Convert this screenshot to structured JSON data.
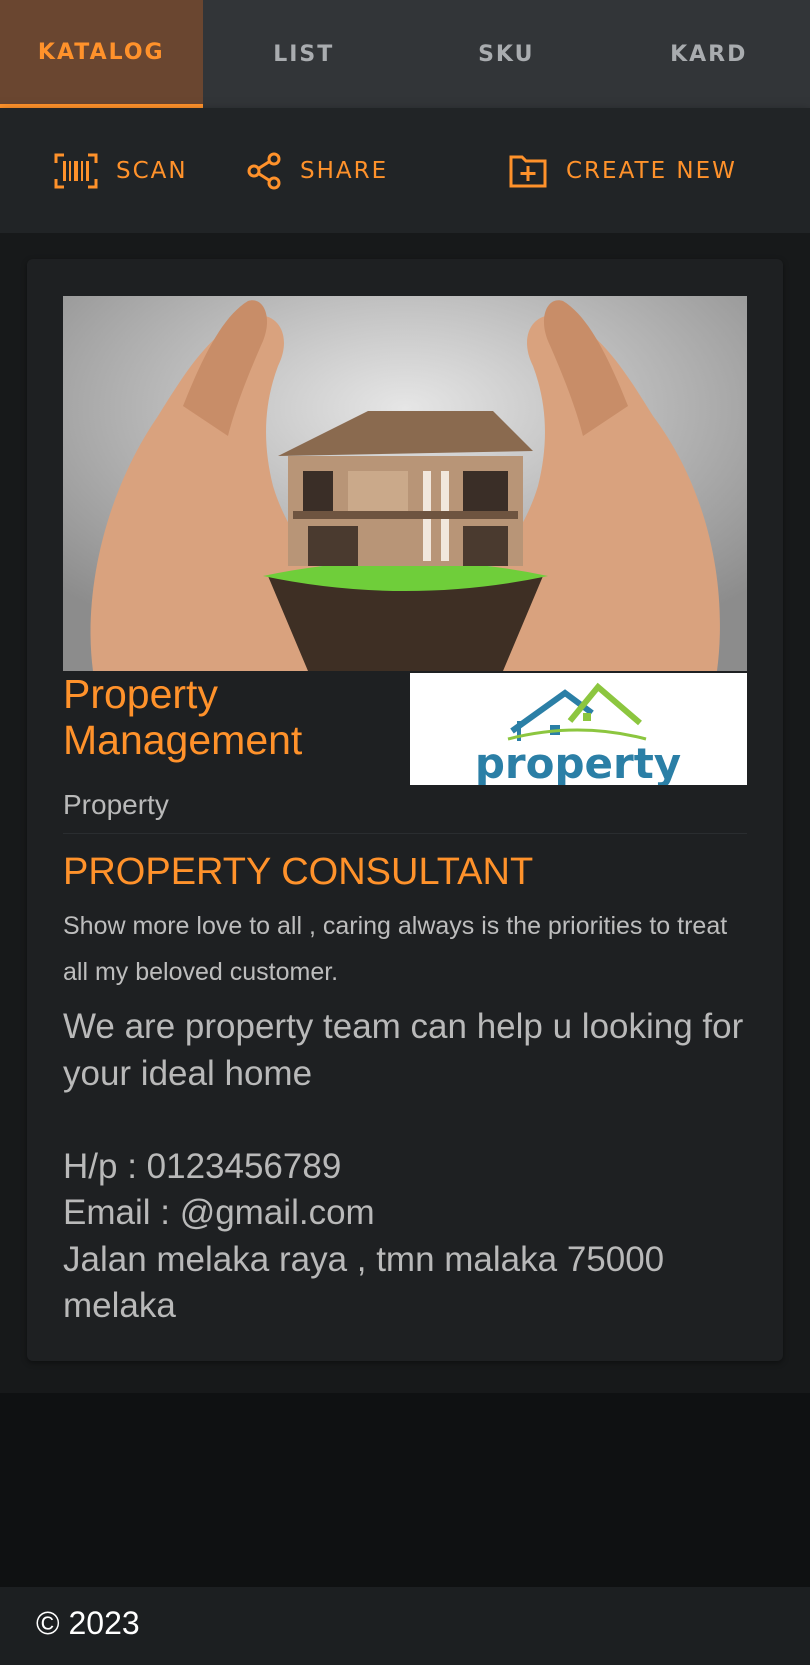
{
  "tabs": [
    {
      "label": "KATALOG",
      "active": true
    },
    {
      "label": "LIST",
      "active": false
    },
    {
      "label": "SKU",
      "active": false
    },
    {
      "label": "KARD",
      "active": false
    }
  ],
  "toolbar": {
    "scan_label": "SCAN",
    "scan_icon": "barcode-scan-icon",
    "share_label": "SHARE",
    "share_icon": "share-icon",
    "create_label": "CREATE NEW",
    "create_icon": "add-box-icon"
  },
  "card": {
    "title": "Property Management",
    "category": "Property",
    "subtitle": "PROPERTY CONSULTANT",
    "description": "Show more love to all , caring always is the priorities to treat all my beloved customer.",
    "body_lines": [
      "We are property team can help u looking for your ideal home",
      "",
      "H/p : 0123456789",
      "Email : @gmail.com",
      "Jalan melaka raya , tmn malaka 75000 melaka"
    ],
    "logo_text": "property"
  },
  "footer": {
    "copyright": "© 2023"
  },
  "colors": {
    "accent": "#ff922b",
    "background": "#0f1112",
    "card": "#1e2022"
  }
}
